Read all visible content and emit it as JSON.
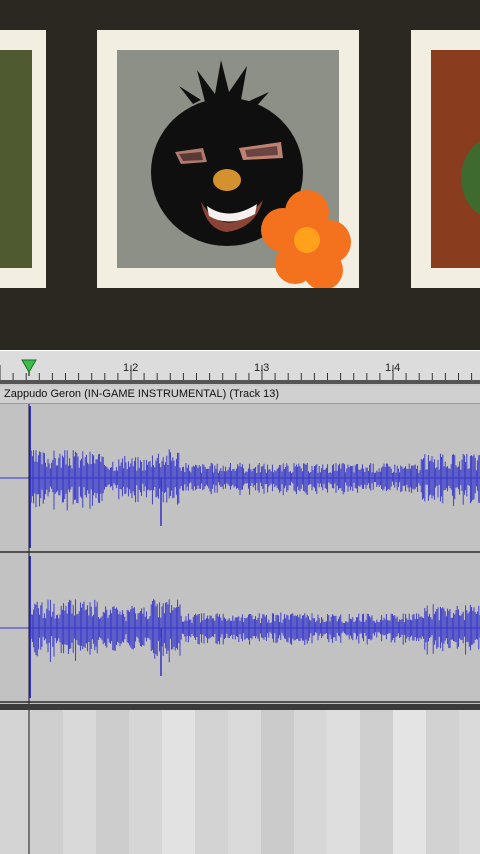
{
  "ruler": {
    "ticks": [
      "1.2",
      "1.3",
      "1.4"
    ]
  },
  "track": {
    "title": "Zappudo Geron (IN-GAME INSTRUMENTAL) (Track 13)"
  },
  "icons": {
    "playhead": "playhead-triangle-icon",
    "flower": "flower-icon"
  },
  "colors": {
    "waveform": "#3333cc",
    "track_bg": "#c0c0c0",
    "card_frame": "#f2eee2",
    "flower": "#f4711d",
    "flower_center": "#ffa11a",
    "playhead": "#3bbf4a"
  }
}
